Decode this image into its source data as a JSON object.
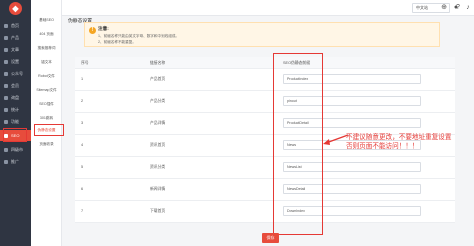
{
  "sidebar": {
    "logo_glyph": "◆",
    "items": [
      {
        "label": "首页",
        "icon": "home-icon"
      },
      {
        "label": "产品",
        "icon": "box-icon"
      },
      {
        "label": "文章",
        "icon": "doc-icon"
      },
      {
        "label": "设置",
        "icon": "gear-icon"
      },
      {
        "label": "公众号",
        "icon": "wechat-icon"
      },
      {
        "label": "会员",
        "icon": "user-icon"
      },
      {
        "label": "询盘",
        "icon": "mail-icon"
      },
      {
        "label": "统计",
        "icon": "chart-icon"
      },
      {
        "label": "功能",
        "icon": "grid-icon"
      },
      {
        "label": "SEO",
        "icon": "seo-icon"
      },
      {
        "label": "四级市",
        "icon": "map-icon"
      },
      {
        "label": "推广",
        "icon": "promo-icon"
      }
    ]
  },
  "subnav": {
    "items": [
      {
        "label": "基础SEO"
      },
      {
        "label": "404 页面"
      },
      {
        "label": "搜索推荐词"
      },
      {
        "label": "锚文本"
      },
      {
        "label": "Robot文件"
      },
      {
        "label": "Sitemap文件"
      },
      {
        "label": "SEO插件"
      },
      {
        "label": "301跳转"
      },
      {
        "label": "外部链接"
      },
      {
        "label": "伪静态设置"
      },
      {
        "label": "页面收录"
      }
    ]
  },
  "header": {
    "language": "中文站",
    "icons": [
      "help-icon",
      "bell-icon",
      "globe-icon",
      "user-icon"
    ]
  },
  "page": {
    "title": "伪静态设置",
    "notice_title": "注意:",
    "notice_lines": [
      "1、前缀名称只能由英文字母、数字和中划线组成。",
      "2、前缀名称不能重复。"
    ],
    "save_label": "保存"
  },
  "table": {
    "headers": {
      "no": "序号",
      "name": "链接名称",
      "prefix": "SEO伪静态前缀"
    },
    "rows": [
      {
        "no": "1",
        "name": "产品首页",
        "prefix": "ProductIndex"
      },
      {
        "no": "2",
        "name": "产品分类",
        "prefix": "pinout"
      },
      {
        "no": "3",
        "name": "产品详情",
        "prefix": "ProductDetail"
      },
      {
        "no": "4",
        "name": "资讯首页",
        "prefix": "News"
      },
      {
        "no": "5",
        "name": "资讯分类",
        "prefix": "NewsList"
      },
      {
        "no": "6",
        "name": "新闻详情",
        "prefix": "NewsDetail"
      },
      {
        "no": "7",
        "name": "下载首页",
        "prefix": "DownIndex"
      }
    ]
  },
  "annotation": {
    "text": "不建议随意更改，不要地址重复设置否则页面不能访问！！！",
    "color": "#e53935"
  },
  "colors": {
    "accent": "#e74c3c",
    "sidebar": "#2f3542"
  }
}
